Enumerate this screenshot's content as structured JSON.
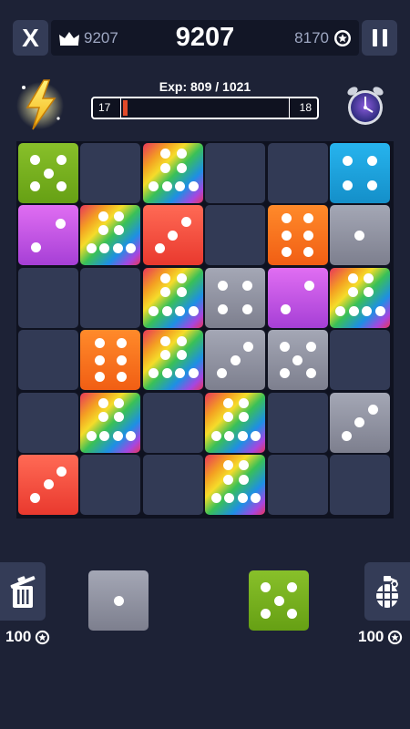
{
  "header": {
    "close_label": "X",
    "best_score": "9207",
    "score": "9207",
    "coins": "8170"
  },
  "exp": {
    "label": "Exp: 809 / 1021",
    "current_level": "17",
    "next_level": "18",
    "progress": 0.03
  },
  "colors": {
    "background": "#1d2236",
    "empty_cell": "#323a55",
    "exp_fill": "#e04a2a"
  },
  "board": {
    "rows": [
      [
        {
          "color": "green",
          "pips": 5
        },
        null,
        {
          "color": "rainbow",
          "pips": 8
        },
        null,
        null,
        {
          "color": "blue",
          "pips": 4
        }
      ],
      [
        {
          "color": "purple",
          "pips": 2
        },
        {
          "color": "rainbow",
          "pips": 8
        },
        {
          "color": "red",
          "pips": 3
        },
        null,
        {
          "color": "orange",
          "pips": 6
        },
        {
          "color": "gray",
          "pips": 1
        }
      ],
      [
        null,
        null,
        {
          "color": "rainbow",
          "pips": 8
        },
        {
          "color": "gray",
          "pips": 4
        },
        {
          "color": "purple",
          "pips": 2
        },
        {
          "color": "rainbow",
          "pips": 8
        }
      ],
      [
        null,
        {
          "color": "orange",
          "pips": 6
        },
        {
          "color": "rainbow",
          "pips": 8
        },
        {
          "color": "gray",
          "pips": 3
        },
        {
          "color": "gray",
          "pips": 5
        },
        null
      ],
      [
        null,
        {
          "color": "rainbow",
          "pips": 8
        },
        null,
        {
          "color": "rainbow",
          "pips": 8
        },
        null,
        {
          "color": "gray",
          "pips": 3
        }
      ],
      [
        {
          "color": "red",
          "pips": 3
        },
        null,
        null,
        {
          "color": "rainbow",
          "pips": 8
        },
        null,
        null
      ]
    ]
  },
  "next_pieces": [
    {
      "color": "gray",
      "pips": 1
    },
    {
      "color": "green",
      "pips": 5
    }
  ],
  "tools": {
    "trash": {
      "icon": "trash-icon",
      "cost": "100"
    },
    "bomb": {
      "icon": "grenade-icon",
      "cost": "100"
    }
  }
}
